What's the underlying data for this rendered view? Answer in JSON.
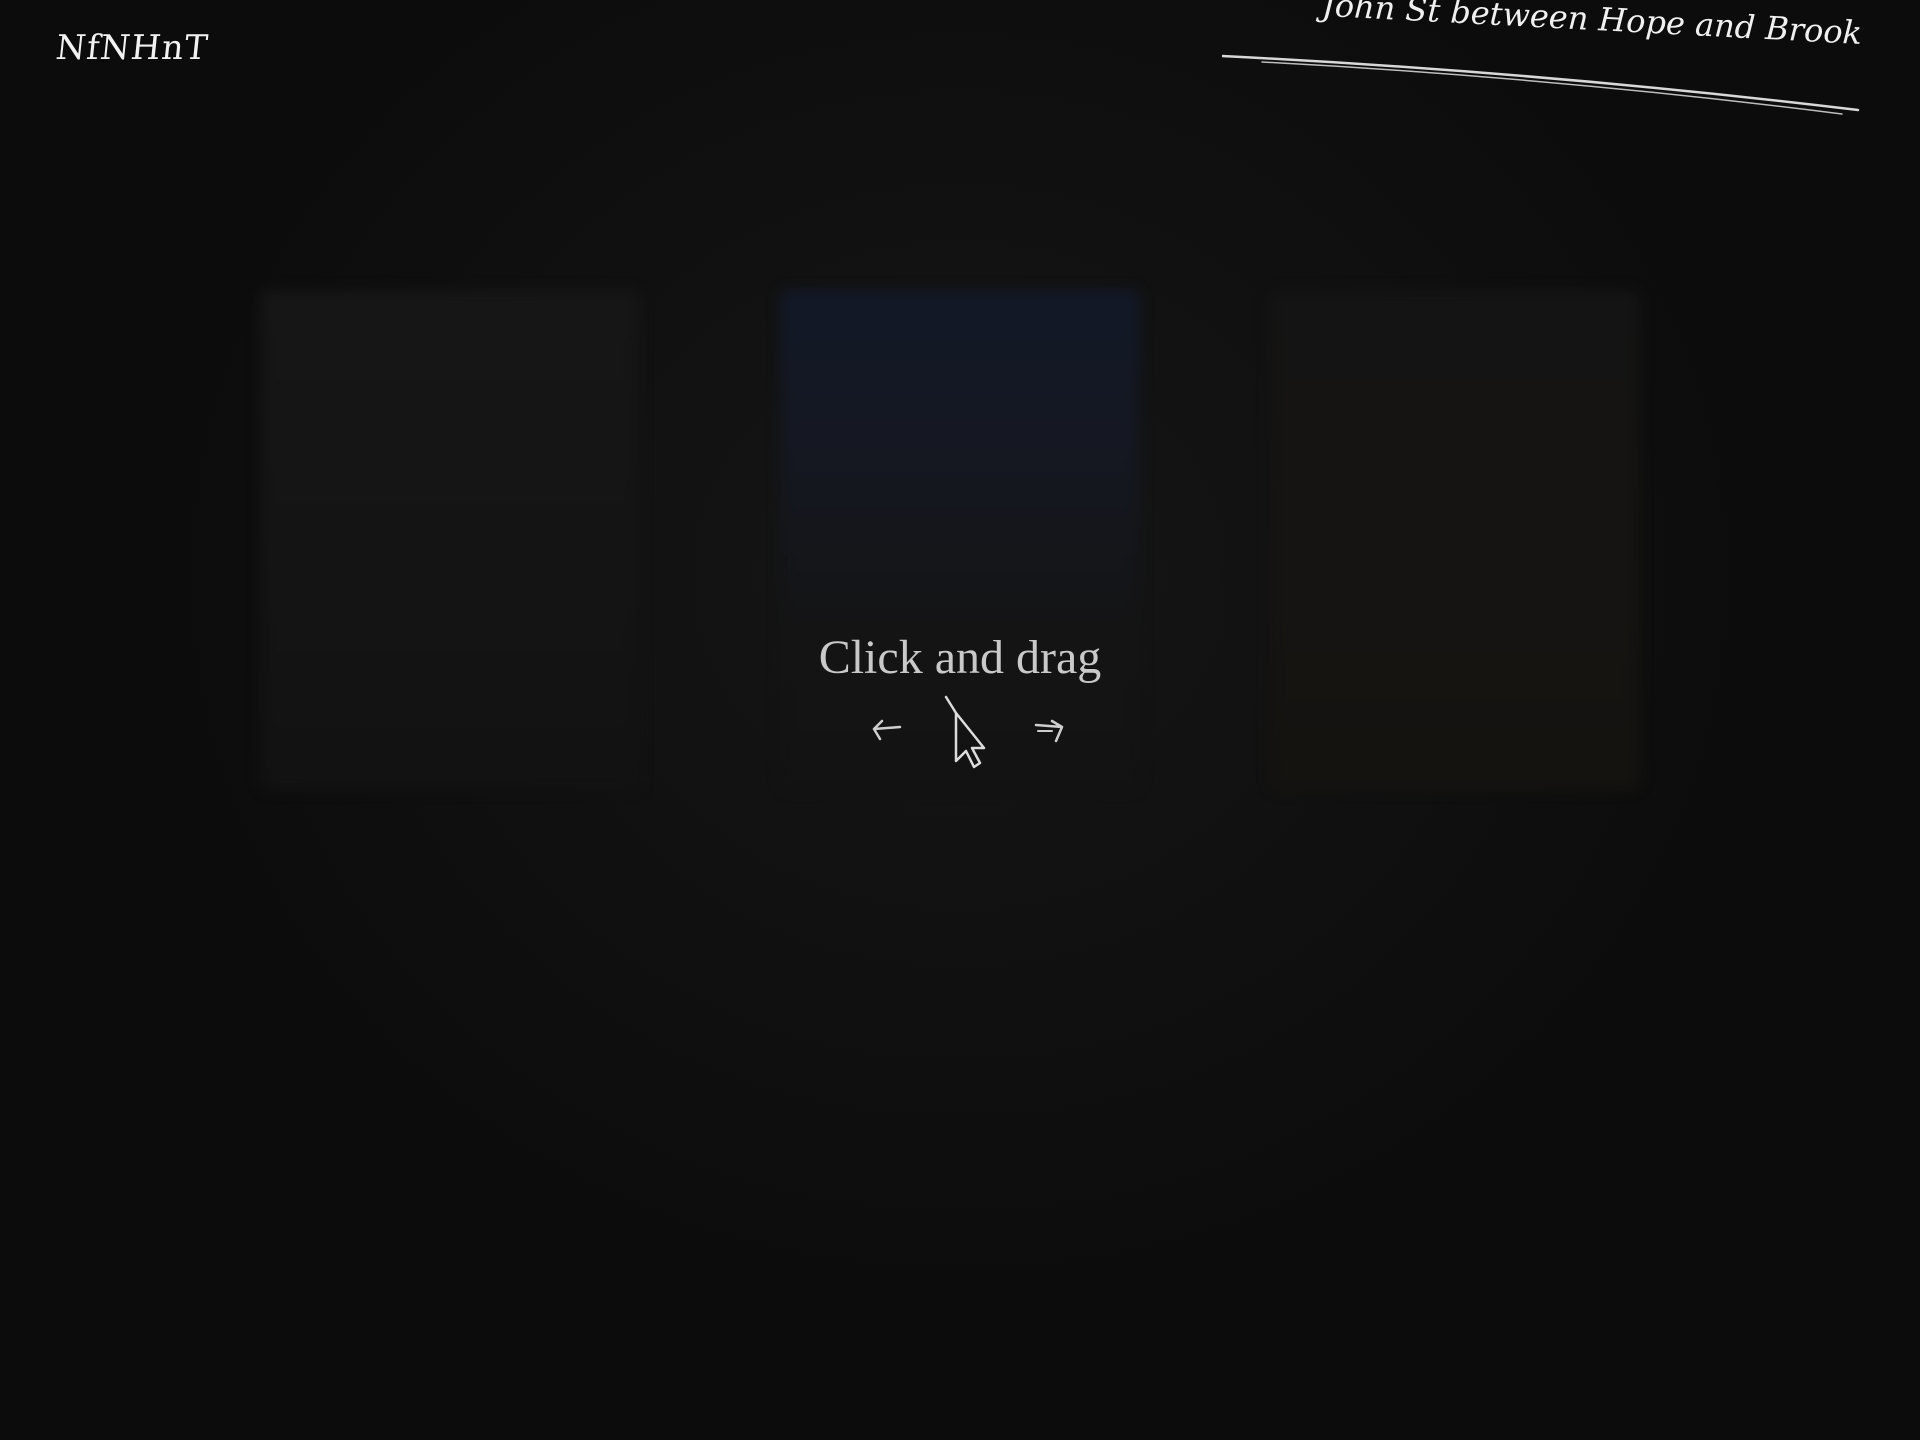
{
  "header": {
    "logo_text": "NfNHnT",
    "location": "John St between Hope and Brook"
  },
  "hint": {
    "text": "Click and drag"
  },
  "icons": {
    "left": "arrow-left-icon",
    "center": "cursor-icon",
    "right": "arrow-right-icon"
  },
  "colors": {
    "background": "#0c0c0c",
    "text": "#e8e8e8",
    "hint_text": "#c9c9c9"
  }
}
